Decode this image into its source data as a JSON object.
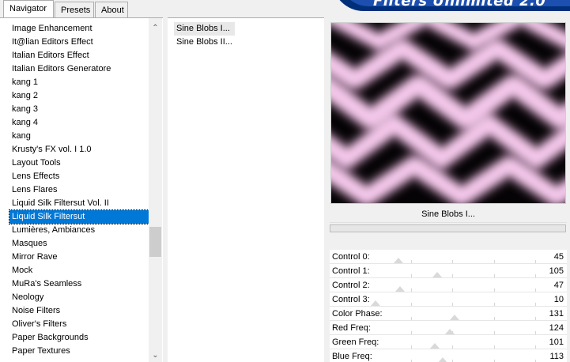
{
  "tabs": [
    {
      "label": "Navigator",
      "active": true
    },
    {
      "label": "Presets",
      "active": false
    },
    {
      "label": "About",
      "active": false
    }
  ],
  "logo": {
    "text": "Filters Unlimited 2.0"
  },
  "categories": [
    "Image Enhancement",
    "It@lian Editors Effect",
    "Italian Editors Effect",
    "Italian Editors Generatore",
    "kang 1",
    "kang 2",
    "kang 3",
    "kang 4",
    "kang",
    "Krusty's FX vol. I 1.0",
    "Layout Tools",
    "Lens Effects",
    "Lens Flares",
    "Liquid Silk Filtersut Vol. II",
    "Liquid Silk Filtersut",
    "Lumières, Ambiances",
    "Masques",
    "Mirror Rave",
    "Mock",
    "MuRa's Seamless",
    "Neology",
    "Noise Filters",
    "Oliver's Filters",
    "Paper Backgrounds",
    "Paper Textures"
  ],
  "selected_category_index": 14,
  "filters": [
    "Sine Blobs I...",
    "Sine Blobs II..."
  ],
  "selected_filter_index": 0,
  "preview": {
    "filter_name": "Sine Blobs I...",
    "colors": {
      "light": "#f2c6e8",
      "mid": "#b98ab0",
      "dark": "#050305"
    }
  },
  "controls": [
    {
      "label": "Control 0:",
      "value": 45
    },
    {
      "label": "Control 1:",
      "value": 105
    },
    {
      "label": "Control 2:",
      "value": 47
    },
    {
      "label": "Control 3:",
      "value": 10
    },
    {
      "label": "Color Phase:",
      "value": 131
    },
    {
      "label": "Red Freq:",
      "value": 124
    },
    {
      "label": "Green Freq:",
      "value": 101
    },
    {
      "label": "Blue Freq:",
      "value": 113
    }
  ]
}
